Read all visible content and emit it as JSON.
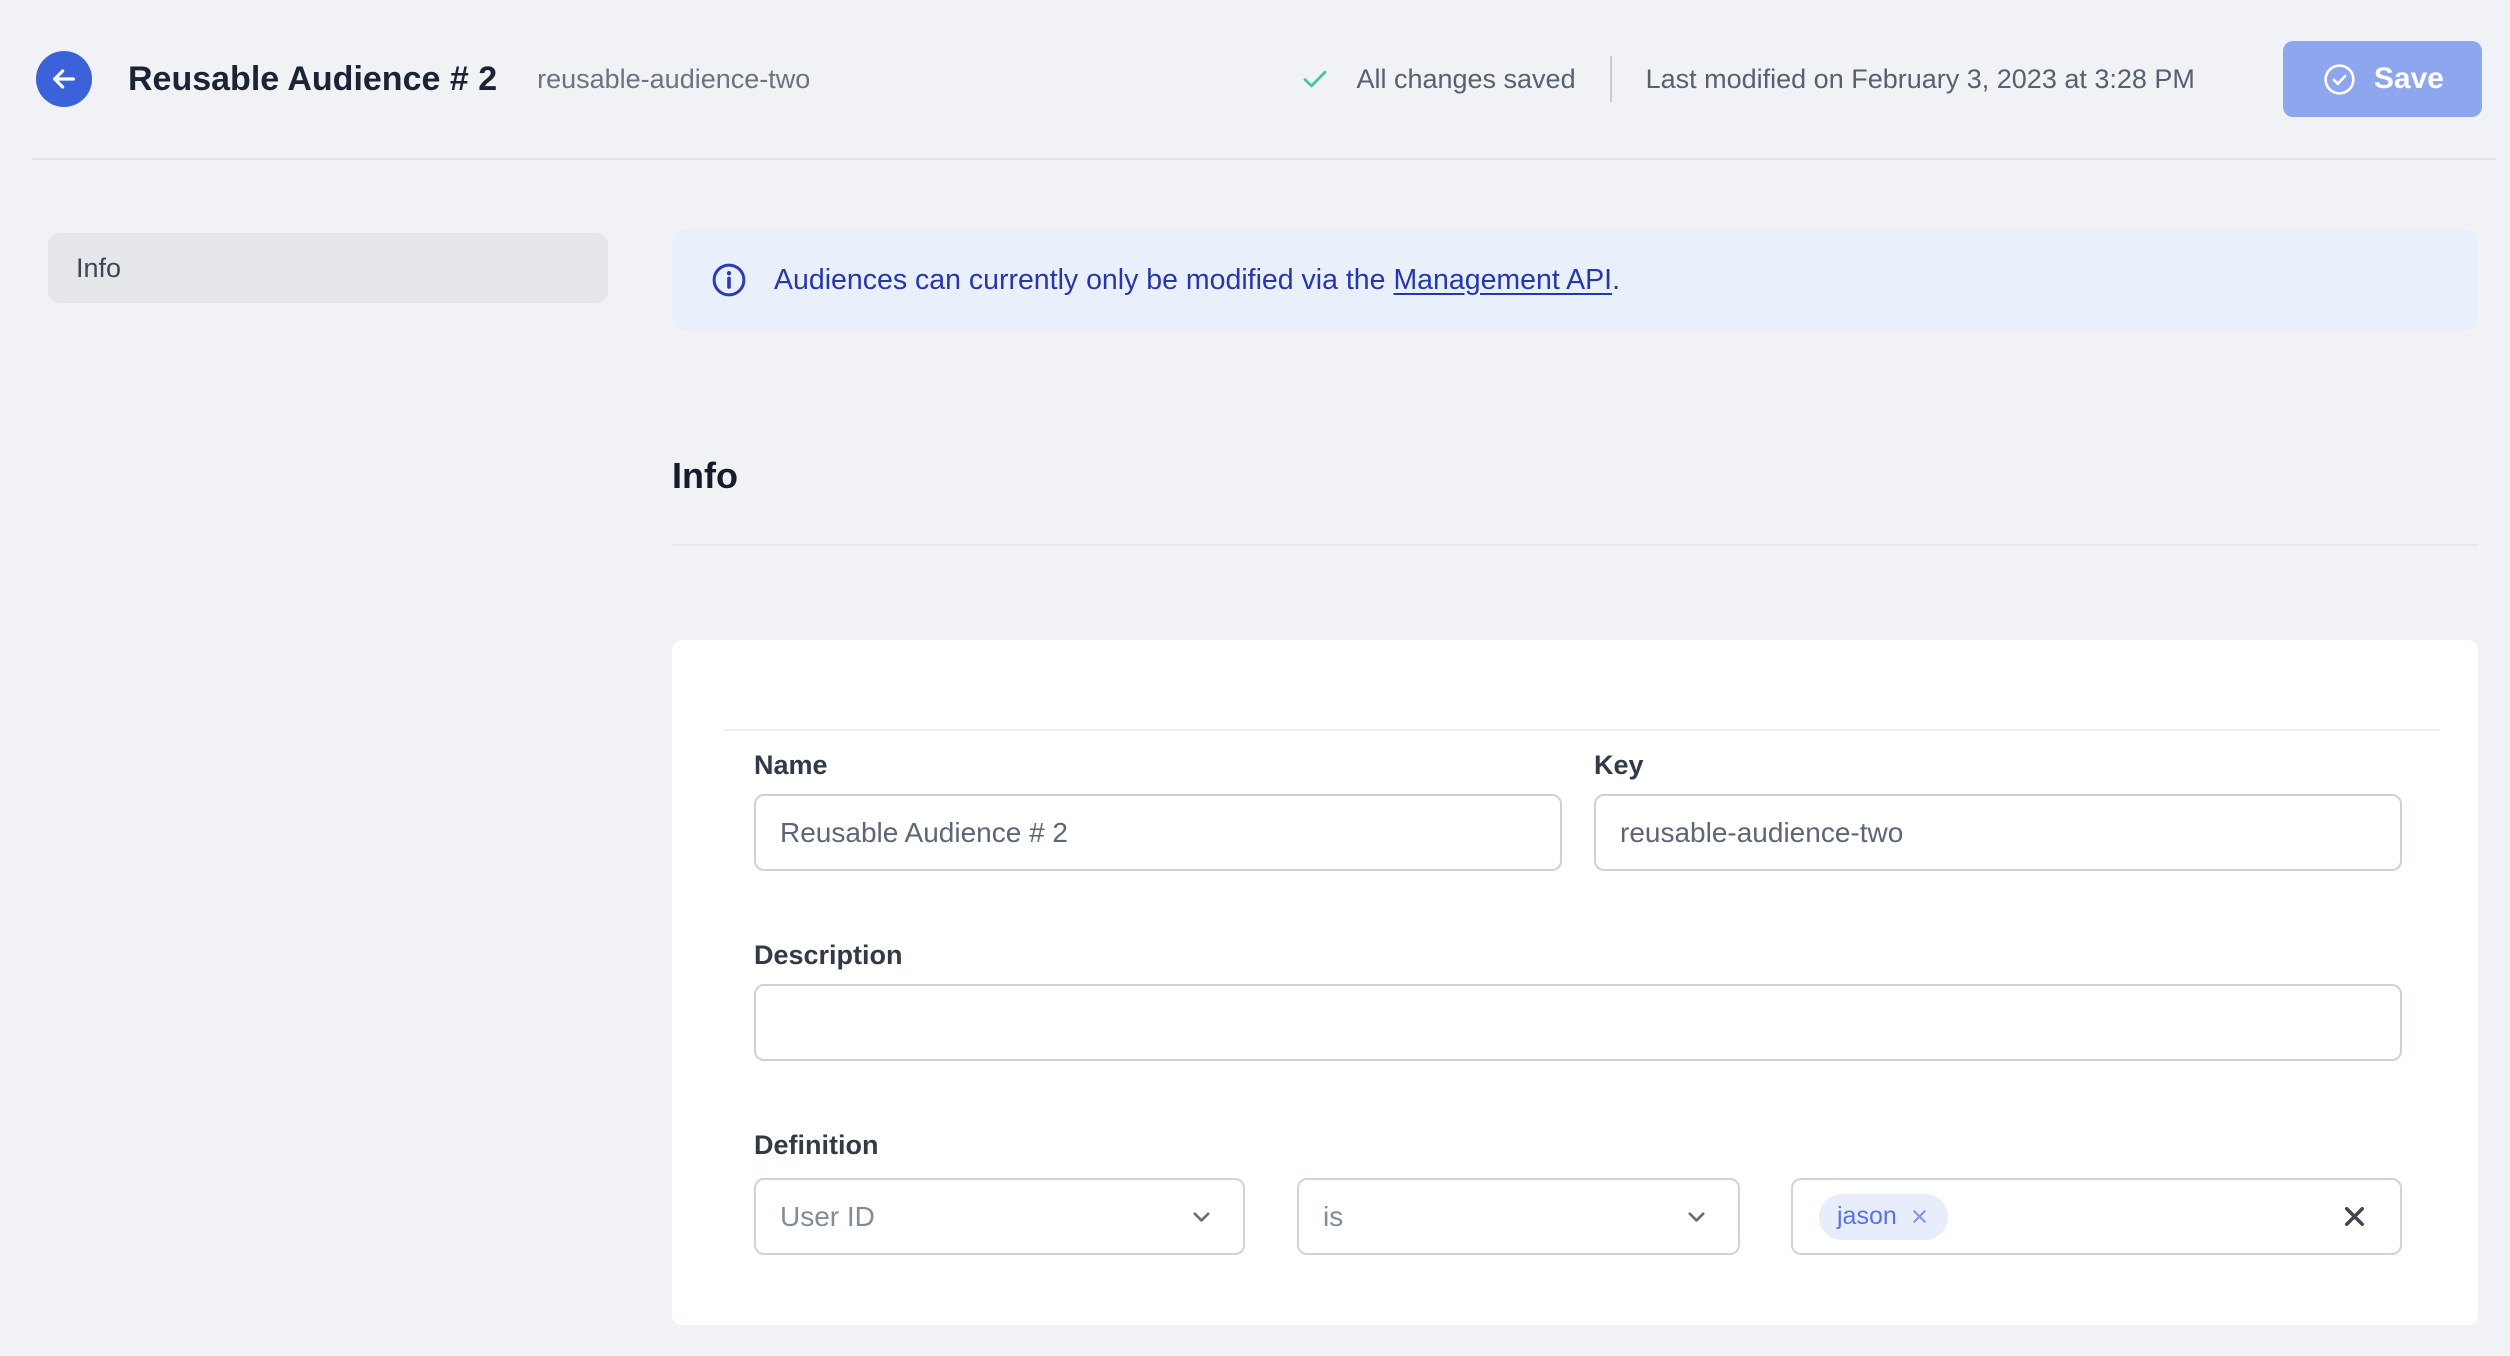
{
  "header": {
    "title": "Reusable Audience # 2",
    "subtitle": "reusable-audience-two",
    "status": "All changes saved",
    "last_modified": "Last modified on February 3, 2023 at 3:28 PM",
    "save_label": "Save"
  },
  "sidebar": {
    "items": [
      {
        "label": "Info",
        "active": true
      }
    ]
  },
  "banner": {
    "text_before": "Audiences can currently only be modified via the ",
    "link_text": "Management API",
    "text_after": "."
  },
  "section": {
    "title": "Info"
  },
  "form": {
    "name": {
      "label": "Name",
      "value": "Reusable Audience # 2"
    },
    "key": {
      "label": "Key",
      "value": "reusable-audience-two"
    },
    "description": {
      "label": "Description",
      "value": ""
    },
    "definition": {
      "label": "Definition",
      "trait_selected": "User ID",
      "operator_selected": "is",
      "values": [
        "jason"
      ]
    }
  },
  "icons": {
    "back": "arrow-left",
    "status": "check",
    "save": "check-circle",
    "banner": "info-circle",
    "selects": "chevron-down",
    "chip_remove": "x",
    "clear_values": "x"
  },
  "colors": {
    "accent_blue": "#3b62d9",
    "save_button_bg": "#8ea6ed",
    "banner_bg": "#e9f0fb",
    "banner_text": "#2737ab",
    "success_teal": "#49c3a3",
    "chip_bg": "#e8edfc",
    "chip_text": "#5673e2",
    "page_bg": "#f1f2f5"
  }
}
